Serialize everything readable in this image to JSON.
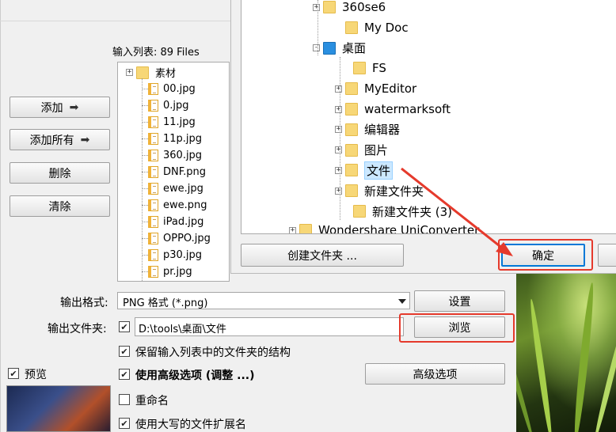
{
  "left_panel": {
    "add_label": "添加",
    "add_all_label": "添加所有",
    "delete_label": "删除",
    "clear_label": "清除"
  },
  "input_list": {
    "header": "输入列表: 89 Files",
    "folder": "素材",
    "files": [
      "00.jpg",
      "0.jpg",
      "11.jpg",
      "11p.jpg",
      "360.jpg",
      "DNF.png",
      "ewe.jpg",
      "ewe.png",
      "iPad.jpg",
      "OPPO.jpg",
      "p30.jpg",
      "pr.jpg"
    ]
  },
  "options": {
    "output_format_label": "输出格式:",
    "output_format_value": "PNG 格式 (*.png)",
    "settings_label": "设置",
    "output_folder_label": "输出文件夹:",
    "output_folder_value": "D:\\tools\\桌面\\文件",
    "browse_label": "浏览",
    "keep_structure_label": "保留输入列表中的文件夹的结构",
    "advanced_options_check_label": "使用高级选项 (调整 ...)",
    "advanced_options_button": "高级选项",
    "rename_label": "重命名",
    "uppercase_ext_label": "使用大写的文件扩展名",
    "preview_label": "预览"
  },
  "folder_dialog": {
    "tree": [
      {
        "label": "360se6",
        "expander": "+"
      },
      {
        "label": "My Doc",
        "expander": ""
      },
      {
        "label": "桌面",
        "expander": "-"
      },
      {
        "label": "FS",
        "expander": ""
      },
      {
        "label": "MyEditor",
        "expander": "+"
      },
      {
        "label": "watermarksoft",
        "expander": "+"
      },
      {
        "label": "编辑器",
        "expander": "+"
      },
      {
        "label": "图片",
        "expander": "+"
      },
      {
        "label": "文件",
        "expander": "+",
        "selected": true
      },
      {
        "label": "新建文件夹",
        "expander": "+"
      },
      {
        "label": "新建文件夹 (3)",
        "expander": ""
      },
      {
        "label": "Wondershare UniConverter",
        "expander": "+"
      }
    ],
    "new_folder_label": "创建文件夹 ...",
    "ok_label": "确定"
  },
  "colors": {
    "highlight": "#e53a2c",
    "selection": "#cce8ff",
    "folder": "#f7d777",
    "accent_blue": "#0078d7"
  }
}
